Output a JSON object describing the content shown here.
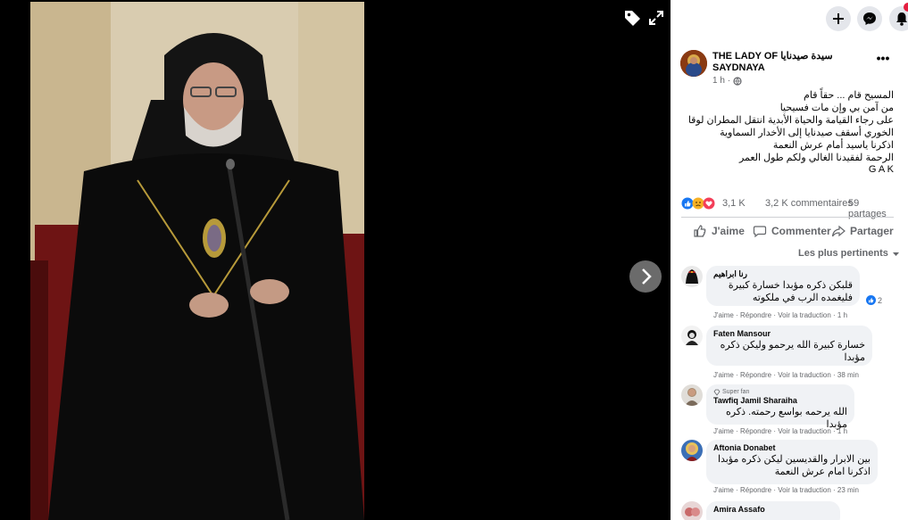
{
  "viewer": {
    "photo_alt": "",
    "tag_icon": "tag-icon",
    "expand_icon": "expand-icon",
    "next_icon": "chevron-right-icon"
  },
  "header": {
    "buttons": [
      "plus-icon",
      "messenger-icon",
      "bell-icon"
    ]
  },
  "post": {
    "page_name": "THE LADY OF سيدة صيدنايا SAYDNAYA",
    "time": "1 h",
    "privacy_icon": "globe-icon",
    "text": "المسيح قام ... حقاً قام\nمن آمن بي وإن مات فسيحيا\nعلى رجاء القيامة والحياة الأبدية انتقل المطران لوقا\nالخوري أسقف صيدنايا إلى الأخدار السماوية\nاذكرنا ياسيد أمام عرش النعمة\nالرحمة لفقيدنا الغالي ولكم طول العمر\nG A K",
    "reaction_count": "3,1 K",
    "comments_count": "3,2 K commentaires",
    "shares_count": "59 partages",
    "actions": {
      "like": "J'aime",
      "comment": "Commenter",
      "share": "Partager"
    },
    "sort_label": "Les plus pertinents"
  },
  "comments": [
    {
      "name": "رنا ابراهيم",
      "text": "قلبكن ذكره مؤبدا خسارة كبيرة\nفليغمده الرب في ملكوته",
      "actions": "J'aime · Répondre · Voir la traduction · 1 h",
      "reactions": "2",
      "badge": ""
    },
    {
      "name": "Faten Mansour",
      "text": "خسارة كبيرة الله يرحمو وليكن ذكره\nمؤبدا",
      "actions": "J'aime · Répondre · Voir la traduction · 38 min",
      "reactions": "",
      "badge": ""
    },
    {
      "name": "Tawfiq Jamil Sharaiha",
      "text": "الله يرحمه بواسع رحمته. ذكره مؤبدا",
      "actions": "J'aime · Répondre · Voir la traduction · 1 h",
      "reactions": "",
      "badge": "Super fan"
    },
    {
      "name": "Aftonia Donabet",
      "text": "بين الابرار والقديسين ليكن ذكره مؤبدا\nاذكرنا امام عرش النعمة",
      "actions": "J'aime · Répondre · Voir la traduction · 23 min",
      "reactions": "",
      "badge": ""
    },
    {
      "name": "Amira Assafo",
      "text": "",
      "actions": "",
      "reactions": "",
      "badge": ""
    }
  ],
  "colors": {
    "viewer_bg": "#000000",
    "like_blue": "#1877f2",
    "text_primary": "#050505",
    "text_secondary": "#65676b",
    "bubble_bg": "#f0f2f5"
  }
}
